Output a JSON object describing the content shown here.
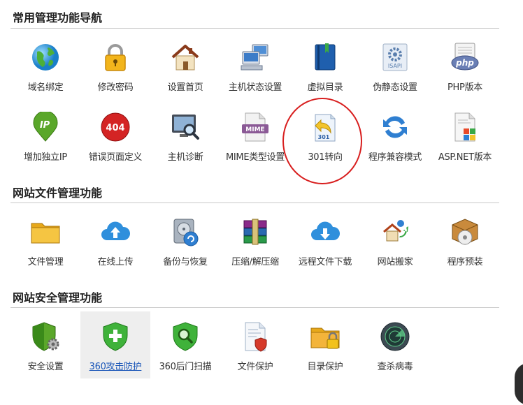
{
  "sections": [
    {
      "title": "常用管理功能导航",
      "rows": [
        [
          {
            "label": "域名绑定",
            "icon": "globe-icon"
          },
          {
            "label": "修改密码",
            "icon": "lock-icon"
          },
          {
            "label": "设置首页",
            "icon": "house-icon"
          },
          {
            "label": "主机状态设置",
            "icon": "computers-icon"
          },
          {
            "label": "虚拟目录",
            "icon": "book-icon"
          },
          {
            "label": "伪静态设置",
            "icon": "isapi-gear-icon",
            "text": "ISAPI"
          },
          {
            "label": "PHP版本",
            "icon": "php-icon",
            "text": "php"
          }
        ],
        [
          {
            "label": "增加独立IP",
            "icon": "ip-pin-icon",
            "text": "IP"
          },
          {
            "label": "错误页面定义",
            "icon": "error-404-icon",
            "text": "404"
          },
          {
            "label": "主机诊断",
            "icon": "monitor-search-icon"
          },
          {
            "label": "MIME类型设置",
            "icon": "mime-file-icon",
            "text": "MIME"
          },
          {
            "label": "301转向",
            "icon": "redirect-301-icon",
            "text": "301"
          },
          {
            "label": "程序兼容模式",
            "icon": "refresh-arrows-icon"
          },
          {
            "label": "ASP.NET版本",
            "icon": "aspnet-file-icon"
          }
        ]
      ]
    },
    {
      "title": "网站文件管理功能",
      "rows": [
        [
          {
            "label": "文件管理",
            "icon": "folder-icon"
          },
          {
            "label": "在线上传",
            "icon": "cloud-upload-icon"
          },
          {
            "label": "备份与恢复",
            "icon": "disk-backup-icon"
          },
          {
            "label": "压缩/解压缩",
            "icon": "archive-books-icon"
          },
          {
            "label": "远程文件下载",
            "icon": "cloud-download-icon"
          },
          {
            "label": "网站搬家",
            "icon": "site-move-icon"
          },
          {
            "label": "程序预装",
            "icon": "install-box-icon"
          }
        ]
      ]
    },
    {
      "title": "网站安全管理功能",
      "rows": [
        [
          {
            "label": "安全设置",
            "icon": "shield-gear-icon"
          },
          {
            "label": "360攻击防护",
            "icon": "shield-plus-icon",
            "active": true
          },
          {
            "label": "360后门扫描",
            "icon": "shield-scan-icon"
          },
          {
            "label": "文件保护",
            "icon": "file-shield-icon"
          },
          {
            "label": "目录保护",
            "icon": "folder-lock-icon"
          },
          {
            "label": "查杀病毒",
            "icon": "radar-icon"
          }
        ]
      ]
    }
  ],
  "colors": {
    "highlight_circle": "#d81e1e",
    "active_link": "#1a56b8"
  }
}
